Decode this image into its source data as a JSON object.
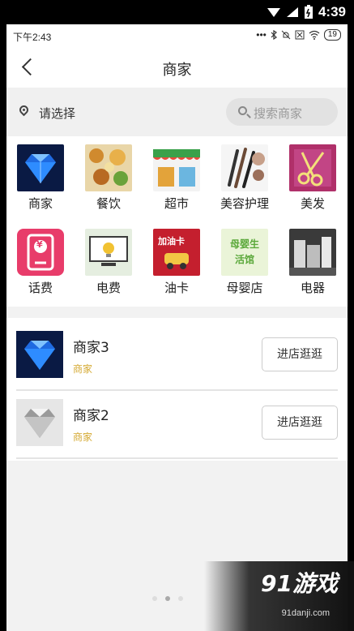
{
  "system_status": {
    "time": "4:39",
    "icons": [
      "signal-icon",
      "wifi-icon",
      "battery-icon"
    ]
  },
  "inner_status": {
    "time": "下午2:43",
    "battery": "19"
  },
  "header": {
    "title": "商家"
  },
  "location_bar": {
    "location_text": "请选择",
    "search_placeholder": "搜索商家"
  },
  "categories": [
    {
      "label": "商家"
    },
    {
      "label": "餐饮"
    },
    {
      "label": "超市"
    },
    {
      "label": "美容护理"
    },
    {
      "label": "美发"
    },
    {
      "label": "话费"
    },
    {
      "label": "电费"
    },
    {
      "label": "油卡"
    },
    {
      "label": "母婴店"
    },
    {
      "label": "电器"
    }
  ],
  "category_image_text": {
    "phone": "¥",
    "gas_card": "加油卡",
    "mother_baby": "母婴生活馆"
  },
  "merchants": [
    {
      "name": "商家3",
      "tag": "商家",
      "button": "进店逛逛"
    },
    {
      "name": "商家2",
      "tag": "商家",
      "button": "进店逛逛"
    }
  ],
  "watermark": {
    "logo": "91游戏",
    "url": "91danji.com"
  },
  "colors": {
    "accent_tag": "#d4a830",
    "background": "#f2f2f2"
  }
}
